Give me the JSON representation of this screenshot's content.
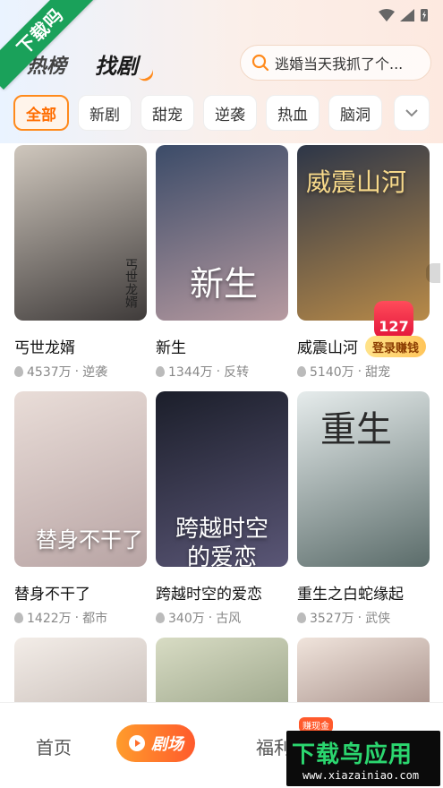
{
  "watermark": {
    "ribbon": "下载吗",
    "logo_main": "下载鸟应用",
    "logo_url": "www.xiazainiao.com"
  },
  "header": {
    "tab_hot": "热榜",
    "tab_find": "找剧",
    "search_placeholder": "逃婚当天我抓了个..."
  },
  "categories": [
    "全部",
    "新剧",
    "甜宠",
    "逆袭",
    "热血",
    "脑洞"
  ],
  "dramas": [
    {
      "title": "丐世龙婿",
      "views": "4537万",
      "tag": "逆袭",
      "poster_text": "丐世龙婿",
      "colors": [
        "#cfc7bd",
        "#3f3b3a"
      ]
    },
    {
      "title": "新生",
      "views": "1344万",
      "tag": "反转",
      "poster_text": "新生",
      "colors": [
        "#3b4b68",
        "#b79aa0"
      ]
    },
    {
      "title": "威震山河",
      "views": "5140万",
      "tag": "甜宠",
      "poster_text": "威震山河",
      "colors": [
        "#2d3648",
        "#b88a48"
      ]
    },
    {
      "title": "替身不干了",
      "views": "1422万",
      "tag": "都市",
      "poster_text": "替身不干了",
      "colors": [
        "#e9ddd8",
        "#b8a4a4"
      ]
    },
    {
      "title": "跨越时空的爱恋",
      "views": "340万",
      "tag": "古风",
      "poster_text": "跨越时空的爱恋",
      "colors": [
        "#1b1e2a",
        "#5a5676"
      ]
    },
    {
      "title": "重生之白蛇缘起",
      "views": "3527万",
      "tag": "武侠",
      "poster_text": "重生",
      "colors": [
        "#e6ecec",
        "#5b6c6a"
      ]
    },
    {
      "poster_text": "",
      "colors": [
        "#f3ede8",
        "#a89a94"
      ]
    },
    {
      "poster_text": "",
      "colors": [
        "#d8dcc4",
        "#6c7a5c"
      ]
    },
    {
      "poster_text": "",
      "colors": [
        "#f0e4dc",
        "#6a4a44"
      ]
    }
  ],
  "gift": {
    "count": "127",
    "label": "登录赚钱"
  },
  "bottom_nav": {
    "home": "首页",
    "theater": "剧场",
    "welfare": "福利",
    "welfare_badge": "赚现金"
  }
}
